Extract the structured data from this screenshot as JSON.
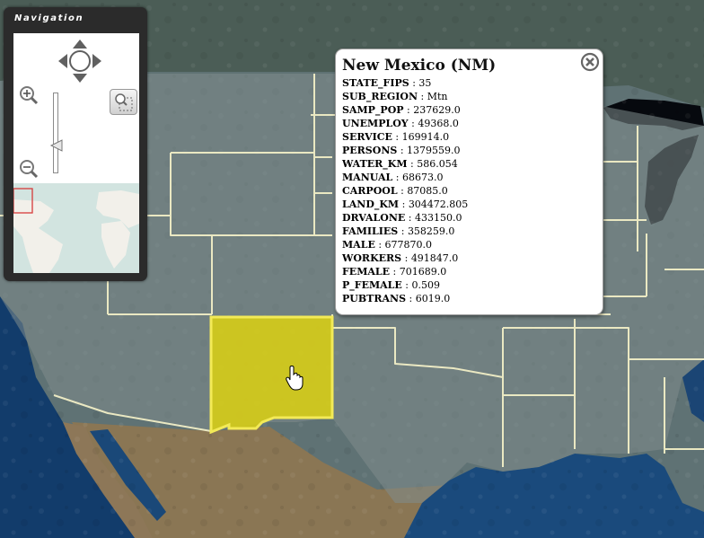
{
  "navigation": {
    "title": "Navigation",
    "pan_icon": "pan-arrows-icon",
    "zoom_in_icon": "zoom-in-icon",
    "zoom_out_icon": "zoom-out-icon",
    "zoom_box_icon": "zoom-box-magnifier-icon",
    "slider_icon": "zoom-slider-handle-icon"
  },
  "map": {
    "highlighted_state": "New Mexico",
    "highlight_color": "#e1d40c",
    "highlight_border": "#f3ea57",
    "boundary_color": "#f1eec6",
    "cursor_icon": "hand-pointer-icon"
  },
  "popup": {
    "title": "New Mexico (NM)",
    "close_icon": "close-circle-icon",
    "attributes": [
      {
        "key": "STATE_FIPS",
        "value": "35"
      },
      {
        "key": "SUB_REGION",
        "value": "Mtn"
      },
      {
        "key": "SAMP_POP",
        "value": "237629.0"
      },
      {
        "key": "UNEMPLOY",
        "value": "49368.0"
      },
      {
        "key": "SERVICE",
        "value": "169914.0"
      },
      {
        "key": "PERSONS",
        "value": "1379559.0"
      },
      {
        "key": "WATER_KM",
        "value": "586.054"
      },
      {
        "key": "MANUAL",
        "value": "68673.0"
      },
      {
        "key": "CARPOOL",
        "value": "87085.0"
      },
      {
        "key": "LAND_KM",
        "value": "304472.805"
      },
      {
        "key": "DRVALONE",
        "value": "433150.0"
      },
      {
        "key": "FAMILIES",
        "value": "358259.0"
      },
      {
        "key": "MALE",
        "value": "677870.0"
      },
      {
        "key": "WORKERS",
        "value": "491847.0"
      },
      {
        "key": "FEMALE",
        "value": "701689.0"
      },
      {
        "key": "P_FEMALE",
        "value": "0.509"
      },
      {
        "key": "PUBTRANS",
        "value": "6019.0"
      }
    ]
  }
}
